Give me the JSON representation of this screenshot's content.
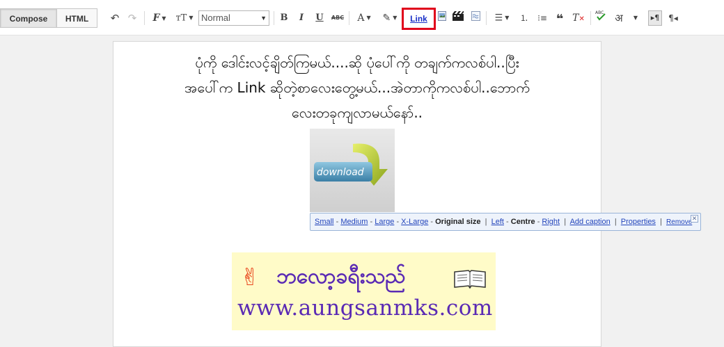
{
  "modes": {
    "compose": "Compose",
    "html": "HTML"
  },
  "toolbar": {
    "format_value": "Normal",
    "link_label": "Link",
    "icons": [
      "undo-icon",
      "redo-icon",
      "font-icon",
      "font-size-icon",
      "bold-icon",
      "italic-icon",
      "underline-icon",
      "strikethrough-icon",
      "text-color-icon",
      "highlight-icon",
      "image-icon",
      "video-icon",
      "jump-break-icon",
      "align-icon",
      "numbered-list-icon",
      "bullet-list-icon",
      "quote-icon",
      "clear-format-icon",
      "spellcheck-icon",
      "transliterate-icon",
      "ltr-icon",
      "rtl-icon"
    ]
  },
  "post": {
    "lines": [
      "ပုံကို ဒေါင်းလင့်ချိတ်ကြမယ်....ဆို  ပုံပေါ်ကို  တချက်ကလစ်ပါ..ပြီး",
      "အပေါ်က Link ဆိုတဲ့စာလေးတွေ့မယ်...အဲတာကိုကလစ်ပါ..ဘောက်",
      "လေးတခုကျလာမယ်နော်.."
    ],
    "thumb_text": "download",
    "banner_title": "ဘလော့ခရီးသည်",
    "banner_url": "www.aungsanmks.com"
  },
  "image_bubble": {
    "sizes": [
      "Small",
      "Medium",
      "Large",
      "X-Large"
    ],
    "current_size": "Original size",
    "align_left": "Left",
    "align_current": "Centre",
    "align_right": "Right",
    "add_caption": "Add caption",
    "properties": "Properties",
    "remove": "Remove"
  }
}
